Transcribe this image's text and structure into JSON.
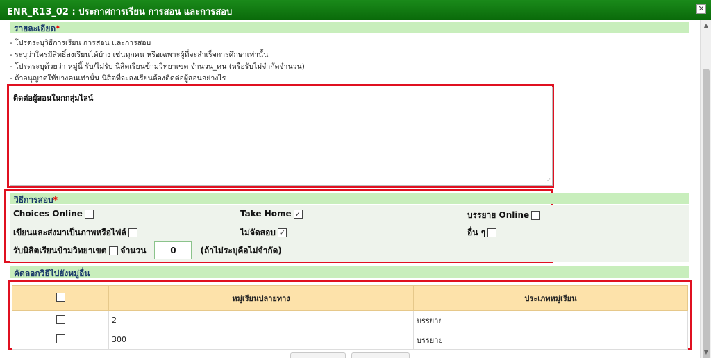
{
  "window": {
    "title": "ENR_R13_02 : ประกาศการเรียน การสอน และการสอบ",
    "close_glyph": "✕"
  },
  "details": {
    "header": "รายละเอียด",
    "required_mark": "*",
    "instructions": [
      "- โปรดระบุวิธีการเรียน การสอน และการสอบ",
      "- ระบุว่าใครมีสิทธิ์ลงเรียนได้บ้าง เช่นทุกคน หรือเฉพาะผู้ที่จะสำเร็จการศึกษาเท่านั้น",
      "- โปรดระบุด้วยว่า หมู่นี้ รับ/ไม่รับ นิสิตเรียนข้ามวิทยาเขต จำนวน_คน (หรือรับไม่จำกัดจำนวน)",
      "- ถ้าอนุญาตให้บางคนเท่านั้น นิสิตที่จะลงเรียนต้องติดต่อผู้สอนอย่างไร"
    ],
    "text_value": "ติดต่อผู้สอนในกกลุ่มไลน์",
    "resize_grip": "⋰"
  },
  "exam": {
    "header": "วิธีการสอบ",
    "required_mark": "*",
    "options": [
      {
        "label": "Choices Online",
        "checked": false
      },
      {
        "label": "Take Home",
        "checked": true
      },
      {
        "label": "บรรยาย Online",
        "checked": false
      },
      {
        "label": "เขียนและส่งมาเป็นภาพหรือไฟล์",
        "checked": false
      },
      {
        "label": "ไม่จัดสอบ",
        "checked": true
      },
      {
        "label": "อื่น ๆ",
        "checked": false
      }
    ],
    "cross_campus_label": "รับนิสิตเรียนข้ามวิทยาเขต",
    "count_label": "จำนวน",
    "count_value": "0",
    "count_note": "(ถ้าไม่ระบุคือไม่จำกัด)"
  },
  "copy": {
    "header": "คัดลอกวิธีไปยังหมู่อื่น",
    "columns": [
      "",
      "หมู่เรียนปลายทาง",
      "ประเภทหมู่เรียน"
    ],
    "rows": [
      {
        "section": "2",
        "type": "บรรยาย"
      },
      {
        "section": "300",
        "type": "บรรยาย"
      }
    ]
  },
  "scrollbar": {
    "up": "▲",
    "down": "▼"
  },
  "check_glyph": "✓"
}
